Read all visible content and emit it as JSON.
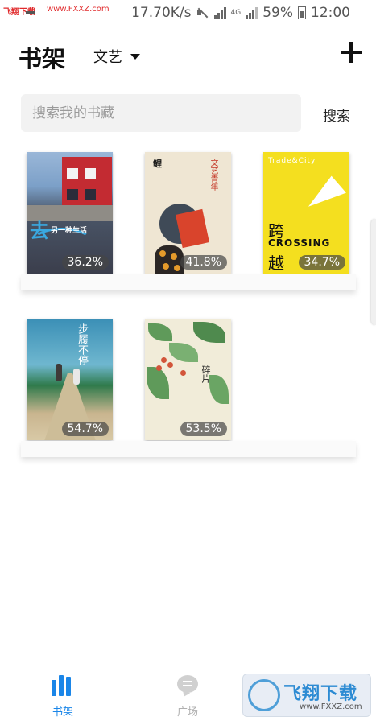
{
  "watermark_top": {
    "site_name": "飞翔下载",
    "url": "www.FXXZ.com"
  },
  "status_bar": {
    "speed": "17.70K/s",
    "net_type": "4G",
    "battery": "59%",
    "time": "12:00"
  },
  "header": {
    "title": "书架",
    "category": "文艺"
  },
  "search": {
    "placeholder": "搜索我的书藏",
    "button_label": "搜索"
  },
  "books": [
    {
      "progress": "36.2%",
      "cover_text": [
        "去",
        "另一种生活"
      ]
    },
    {
      "progress": "41.8%",
      "cover_text": [
        "鲤",
        "文艺青年"
      ]
    },
    {
      "progress": "34.7%",
      "cover_text": [
        "Trade&City",
        "跨",
        "CROSSING",
        "越"
      ]
    },
    {
      "progress": "54.7%",
      "cover_text": [
        "步履不停"
      ]
    },
    {
      "progress": "53.5%",
      "cover_text": [
        "碎片"
      ]
    }
  ],
  "bottom_nav": [
    {
      "label": "书架",
      "active": true,
      "color": "#1b86e8"
    },
    {
      "label": "广场",
      "active": false,
      "color": "#b0b0b0"
    }
  ],
  "watermark_badge": {
    "text": "飞翔下载",
    "url": "www.FXXZ.com"
  }
}
